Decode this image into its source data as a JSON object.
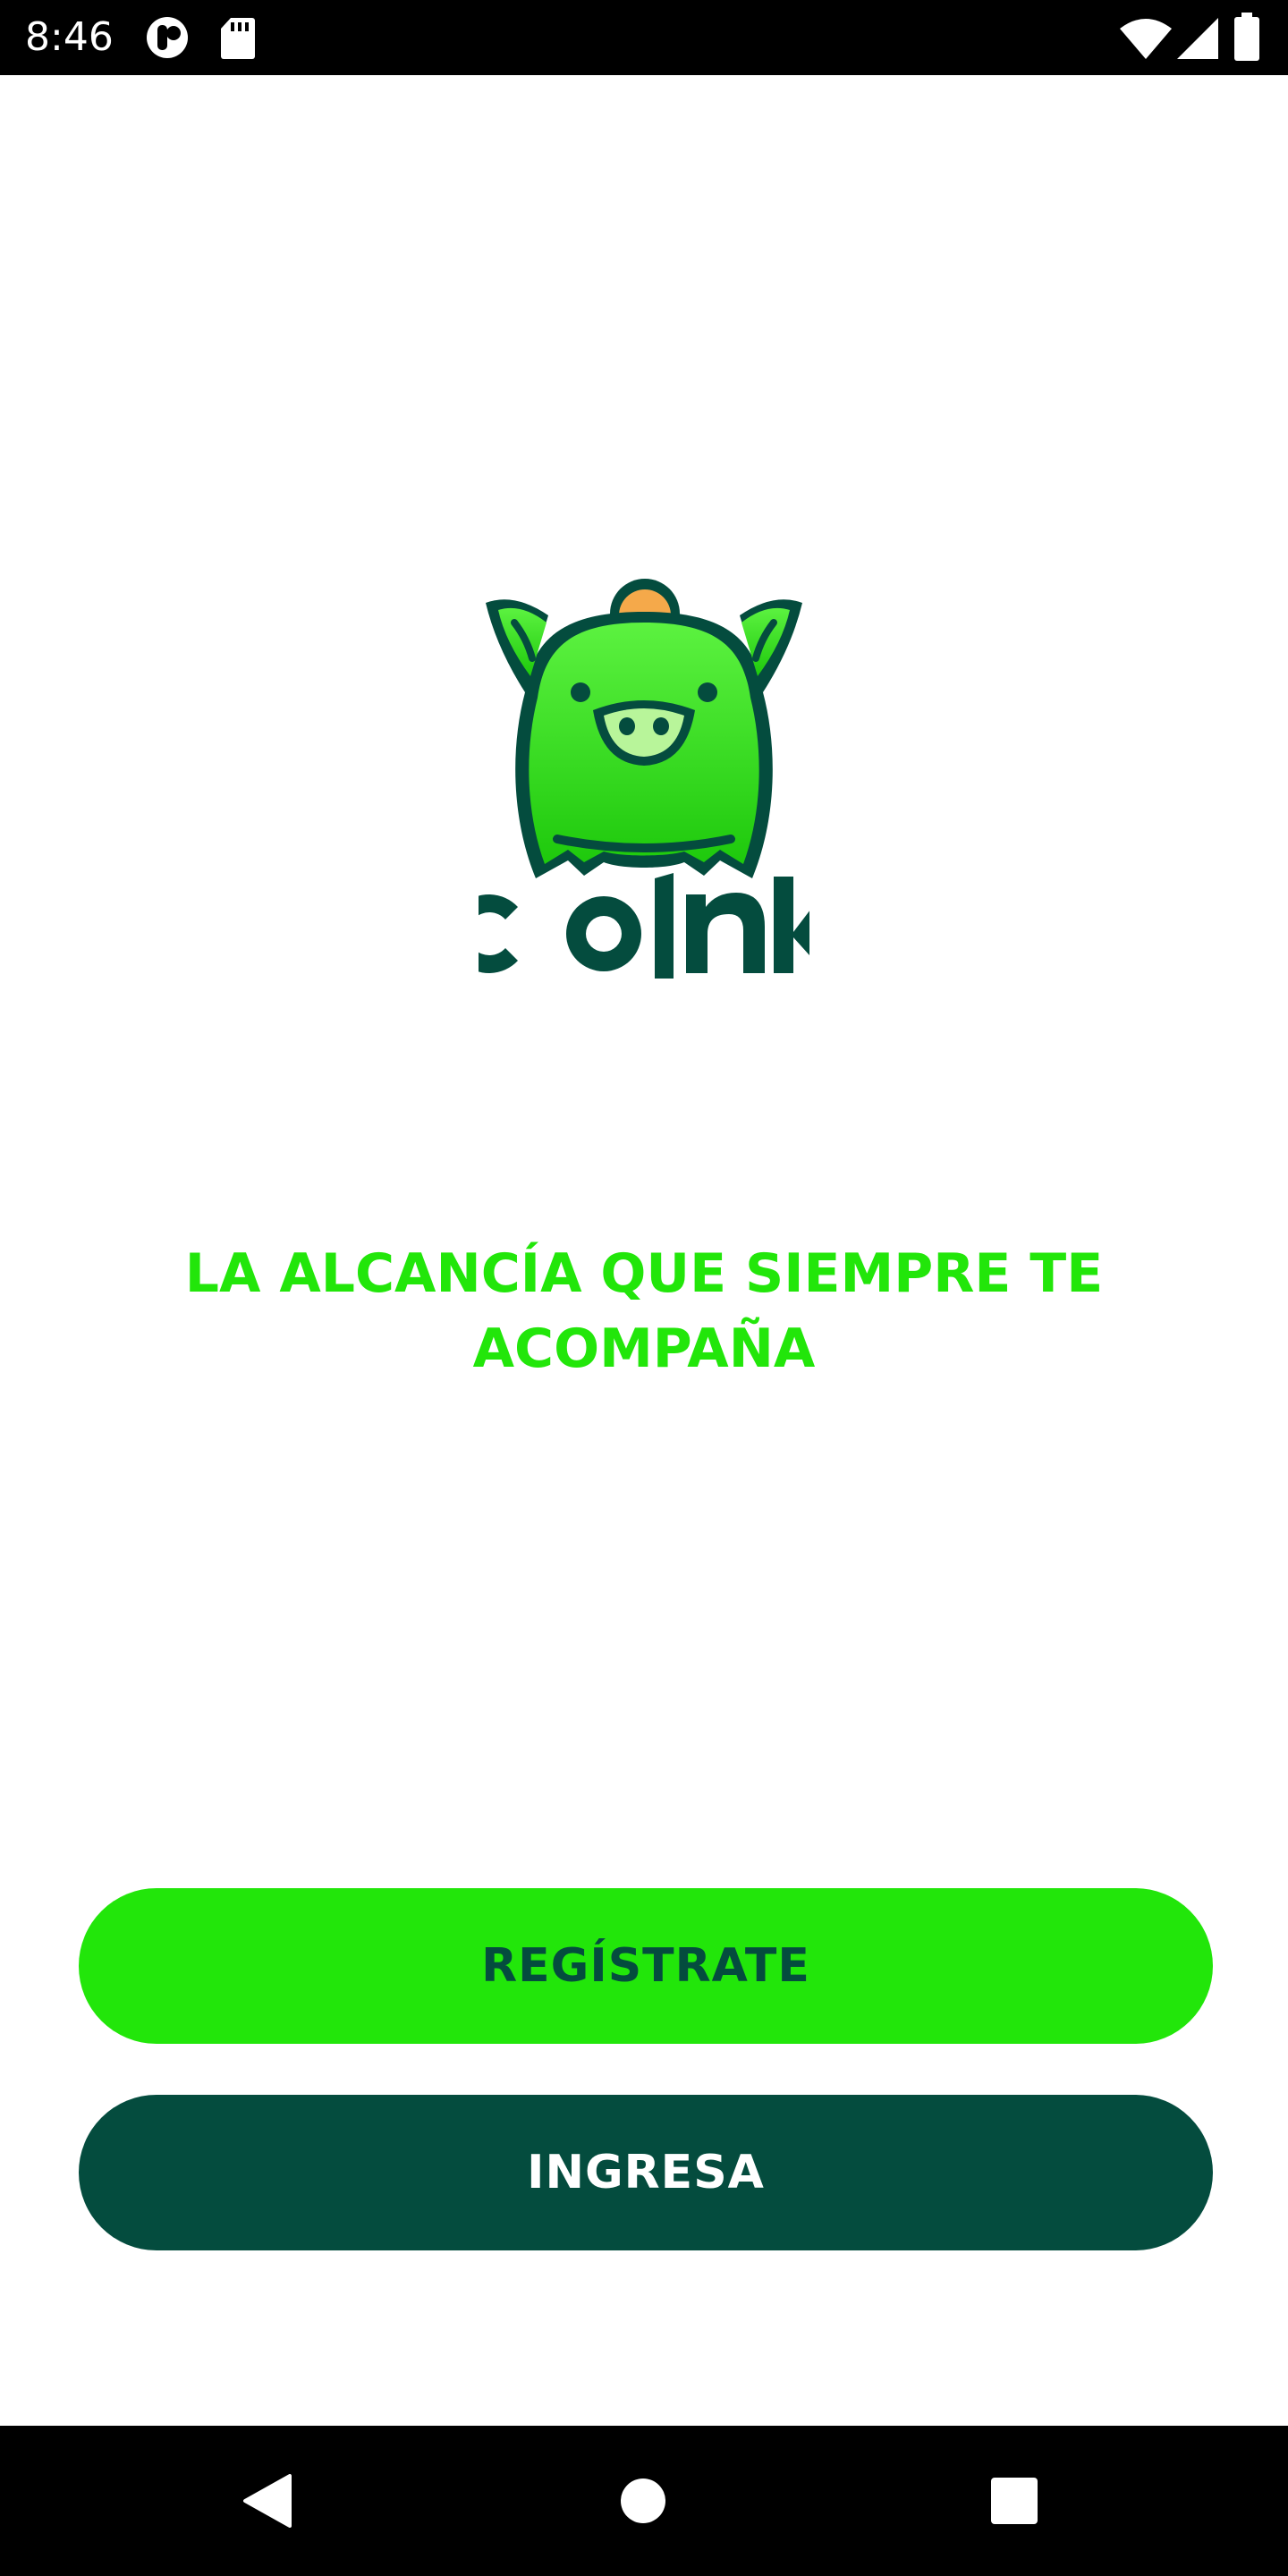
{
  "status_bar": {
    "time": "8:46",
    "icons": [
      "circle-status-icon",
      "sd-card-icon",
      "wifi-icon",
      "signal-icon",
      "battery-icon"
    ]
  },
  "branding": {
    "logo_mascot": "piggy-bank-icon",
    "logo_wordmark": "COINK"
  },
  "tagline": {
    "line1": "LA ALCANCÍA QUE SIEMPRE TE",
    "line2": "ACOMPAÑA"
  },
  "buttons": {
    "register_label": "REGÍSTRATE",
    "login_label": "INGRESA"
  },
  "nav_bar": {
    "icons": [
      "back-icon",
      "home-icon",
      "recents-icon"
    ]
  },
  "colors": {
    "brand_green": "#22e60a",
    "brand_dark": "#044c3e",
    "coin": "#f5a94a"
  }
}
